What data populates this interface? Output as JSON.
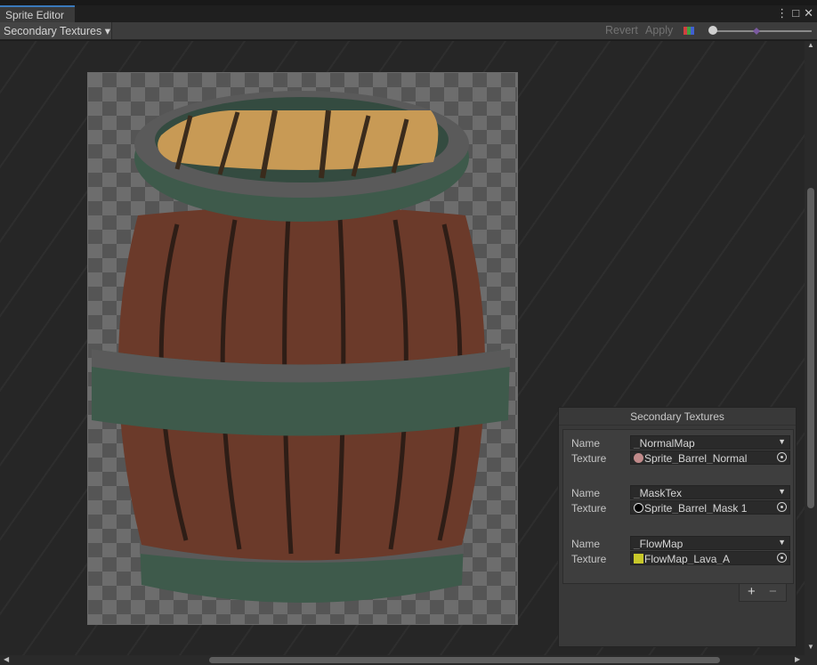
{
  "window": {
    "tab_title": "Sprite Editor",
    "window_menu_glyph": "⋮",
    "maximize_glyph": "□",
    "close_glyph": "✕"
  },
  "toolbar": {
    "mode_dropdown": "Secondary Textures ▾",
    "revert_label": "Revert",
    "apply_label": "Apply",
    "color_channel_icon": "color-channels-icon",
    "zoom_slider_value": 0
  },
  "sprite": {
    "name": "Sprite_Barrel",
    "colors": {
      "wood": "#6b3a2a",
      "wood_shadow": "#5a3023",
      "plank_gap": "#2e1d16",
      "band": "#3e5a4b",
      "rim": "#5a5a5a",
      "top_planks": "#c89a55"
    }
  },
  "secondary_panel": {
    "title": "Secondary Textures",
    "entries": [
      {
        "name_label": "Name",
        "name_value": "_NormalMap",
        "texture_label": "Texture",
        "texture_value": "Sprite_Barrel_Normal",
        "texture_icon": "normal-map-thumbnail-icon",
        "icon_color": "#c08a8a"
      },
      {
        "name_label": "Name",
        "name_value": "_MaskTex",
        "texture_label": "Texture",
        "texture_value": "Sprite_Barrel_Mask 1",
        "texture_icon": "mask-thumbnail-icon",
        "icon_color": "#000000"
      },
      {
        "name_label": "Name",
        "name_value": "_FlowMap",
        "texture_label": "Texture",
        "texture_value": "FlowMap_Lava_A",
        "texture_icon": "flowmap-thumbnail-icon",
        "icon_color": "#c8c82a"
      }
    ],
    "add_label": "+",
    "remove_label": "−"
  },
  "scrollbars": {
    "up_arrow": "▲",
    "down_arrow": "▼",
    "left_arrow": "◀",
    "right_arrow": "▶"
  }
}
